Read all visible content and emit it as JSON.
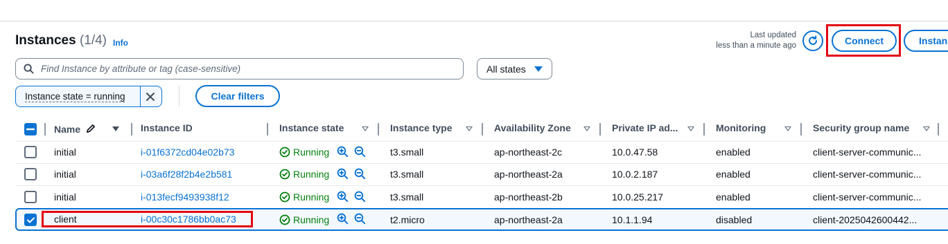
{
  "header": {
    "title": "Instances",
    "count": "(1/4)",
    "info": "Info",
    "last_updated_line1": "Last updated",
    "last_updated_line2": "less than a minute ago",
    "connect_label": "Connect",
    "instances_label": "Instan"
  },
  "filters": {
    "search_placeholder": "Find Instance by attribute or tag (case-sensitive)",
    "state_select": "All states",
    "token": "Instance state = running",
    "clear_label": "Clear filters"
  },
  "table": {
    "columns": [
      "Name",
      "Instance ID",
      "Instance state",
      "Instance type",
      "Availability Zone",
      "Private IP ad...",
      "Monitoring",
      "Security group name"
    ],
    "rows": [
      {
        "selected": false,
        "name": "initial",
        "id": "i-01f6372cd04e02b73",
        "state": "Running",
        "type": "t3.small",
        "az": "ap-northeast-2c",
        "ip": "10.0.47.58",
        "monitoring": "enabled",
        "sg": "client-server-communic..."
      },
      {
        "selected": false,
        "name": "initial",
        "id": "i-03a6f28f2b4e2b581",
        "state": "Running",
        "type": "t3.small",
        "az": "ap-northeast-2a",
        "ip": "10.0.2.187",
        "monitoring": "enabled",
        "sg": "client-server-communic..."
      },
      {
        "selected": false,
        "name": "initial",
        "id": "i-013fecf9493938f12",
        "state": "Running",
        "type": "t3.small",
        "az": "ap-northeast-2b",
        "ip": "10.0.25.217",
        "monitoring": "enabled",
        "sg": "client-server-communic..."
      },
      {
        "selected": true,
        "name": "client",
        "id": "i-00c30c1786bb0ac73",
        "state": "Running",
        "type": "t2.micro",
        "az": "ap-northeast-2a",
        "ip": "10.1.1.94",
        "monitoring": "disabled",
        "sg": "client-2025042600442..."
      }
    ]
  },
  "colors": {
    "accent": "#0972d3",
    "running": "#037f0c",
    "highlight": "#e30613"
  },
  "icons": [
    "search-icon",
    "refresh-icon",
    "close-icon",
    "edit-icon",
    "status-check-icon",
    "zoom-in-icon",
    "zoom-out-icon"
  ]
}
